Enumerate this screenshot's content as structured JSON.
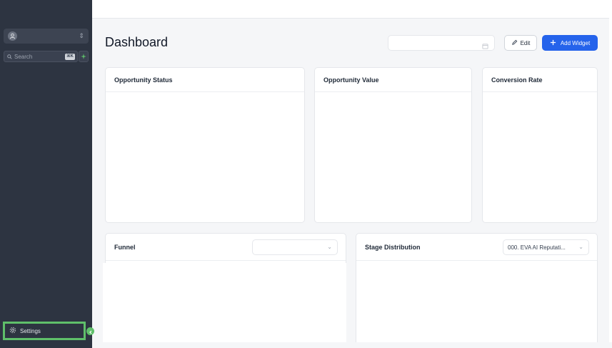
{
  "sidebar": {
    "search_placeholder": "Search",
    "search_shortcut": "⌘K",
    "settings_label": "Settings"
  },
  "header": {
    "title": "Dashboard",
    "edit_label": "Edit",
    "add_widget_label": "Add Widget"
  },
  "cards": {
    "opportunity_status": "Opportunity Status",
    "opportunity_value": "Opportunity Value",
    "conversion_rate": "Conversion Rate",
    "funnel": "Funnel",
    "stage_distribution": "Stage Distribution",
    "stage_distribution_select": "000. EVA AI Reputati..."
  },
  "colors": {
    "sidebar": "#2d3441",
    "accent": "#2563eb",
    "highlight": "#5fbf6a"
  }
}
